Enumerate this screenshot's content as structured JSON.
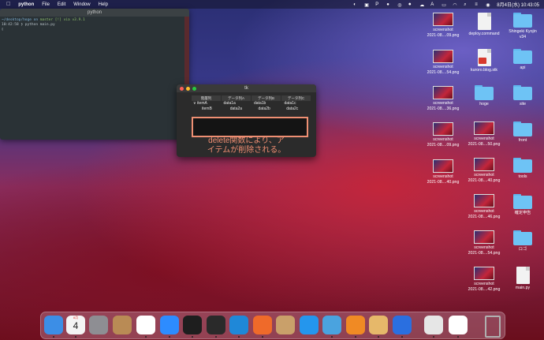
{
  "menubar": {
    "app": "python",
    "menus": [
      "File",
      "Edit",
      "Window",
      "Help"
    ],
    "datetime": "8月4日(水) 10:43:05"
  },
  "terminal": {
    "title": "python",
    "line1_path": "~/desktop/hoge on",
    "line1_branch": "master [!] via",
    "line1_version": "v3.9.1",
    "line2": "10:42:58 ❯ python main.py",
    "line3": "▯"
  },
  "tkwin": {
    "title": "tk",
    "columns": [
      "階層列",
      "データ列A",
      "データ列B",
      "データ列C"
    ],
    "rows": [
      [
        "∨ itemA",
        "data1a",
        "data1b",
        "data1c"
      ],
      [
        "itemB",
        "data2a",
        "data2b",
        "data2c"
      ]
    ]
  },
  "annotation": {
    "line1": "delete関数により、ア",
    "line2": "イテムが削除される。"
  },
  "desktop": {
    "col1": [
      {
        "label1": "screenshot",
        "label2": "2021-08....09.png",
        "kind": "shot"
      },
      {
        "label1": "screenshot",
        "label2": "2021-08....54.png",
        "kind": "shot"
      },
      {
        "label1": "screenshot",
        "label2": "2021-08....36.png",
        "kind": "shot"
      },
      {
        "label1": "screenshot",
        "label2": "2021-08....09.png",
        "kind": "shot"
      },
      {
        "label1": "screenshot",
        "label2": "2021-08....40.png",
        "kind": "shot"
      }
    ],
    "col2": [
      {
        "label1": "deploy.command",
        "label2": "",
        "kind": "file"
      },
      {
        "label1": "kuroro.blog.stk",
        "label2": "",
        "kind": "file-red"
      },
      {
        "label1": "hoge",
        "label2": "",
        "kind": "folder"
      },
      {
        "label1": "screenshot",
        "label2": "2021-08....50.png",
        "kind": "shot"
      },
      {
        "label1": "screenshot",
        "label2": "2021-08....40.png",
        "kind": "shot"
      },
      {
        "label1": "screenshot",
        "label2": "2021-08....46.png",
        "kind": "shot"
      },
      {
        "label1": "screenshot",
        "label2": "2021-08....54.png",
        "kind": "shot"
      },
      {
        "label1": "screenshot",
        "label2": "2021-08....42.png",
        "kind": "shot"
      }
    ],
    "col3": [
      {
        "label1": "Shingeki Kyojin",
        "label2": "v34",
        "kind": "folder"
      },
      {
        "label1": "api",
        "label2": "",
        "kind": "folder"
      },
      {
        "label1": "site",
        "label2": "",
        "kind": "folder"
      },
      {
        "label1": "front",
        "label2": "",
        "kind": "folder"
      },
      {
        "label1": "tools",
        "label2": "",
        "kind": "folder"
      },
      {
        "label1": "確定申告",
        "label2": "",
        "kind": "folder"
      },
      {
        "label1": "ロゴ",
        "label2": "",
        "kind": "folder"
      },
      {
        "label1": "main.py",
        "label2": "",
        "kind": "file"
      }
    ]
  },
  "dock": {
    "calendar_month": "8月",
    "calendar_day": "4",
    "apps": [
      {
        "name": "finder-icon",
        "color": "#3c8ee6"
      },
      {
        "name": "calendar-icon",
        "color": "#f4f4f4"
      },
      {
        "name": "system-preferences-icon",
        "color": "#8e8e93"
      },
      {
        "name": "contacts-icon",
        "color": "#b98b55"
      },
      {
        "name": "chrome-icon",
        "color": "#ffffff"
      },
      {
        "name": "zoom-icon",
        "color": "#2d8cff"
      },
      {
        "name": "iterm-icon",
        "color": "#1e1e1e"
      },
      {
        "name": "terminal-icon",
        "color": "#2a2a2a"
      },
      {
        "name": "vscode-icon",
        "color": "#1f88d8"
      },
      {
        "name": "activity-chart-icon",
        "color": "#ef6a2a"
      },
      {
        "name": "installer-icon",
        "color": "#c9a06a"
      },
      {
        "name": "docker-icon",
        "color": "#2496ed"
      },
      {
        "name": "quicktime-icon",
        "color": "#4aa3df"
      },
      {
        "name": "sourcetree-icon",
        "color": "#f08a24"
      },
      {
        "name": "preview-icon",
        "color": "#e6b86a"
      },
      {
        "name": "infinity-icon",
        "color": "#2a6fe0"
      },
      {
        "name": "screenshot-app-icon",
        "color": "#e6e6e6"
      },
      {
        "name": "document-icon",
        "color": "#ffffff"
      },
      {
        "name": "trash-icon",
        "color": "#b0b0b0"
      }
    ]
  }
}
